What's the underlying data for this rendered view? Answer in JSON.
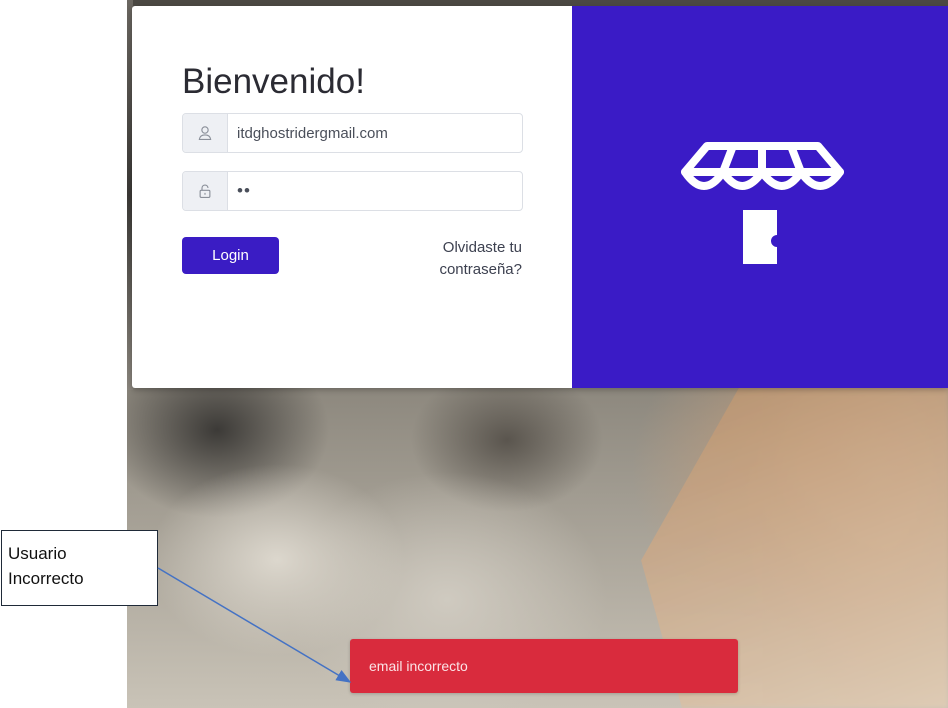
{
  "login": {
    "title": "Bienvenido!",
    "email_value": "itdghostridergmail.com",
    "password_value": "••",
    "login_label": "Login",
    "forgot_line1": "Olvidaste tu",
    "forgot_line2": "contraseña?"
  },
  "icons": {
    "user": "user-icon",
    "lock": "lock-icon",
    "brand": "storefront-logo"
  },
  "toast": {
    "message": "email incorrecto"
  },
  "annotation": {
    "line1": "Usuario",
    "line2": "Incorrecto"
  },
  "colors": {
    "brand": "#3a1bc6",
    "button": "#3a1cc4",
    "toast": "#d92b3d",
    "arrow": "#4472c4"
  }
}
